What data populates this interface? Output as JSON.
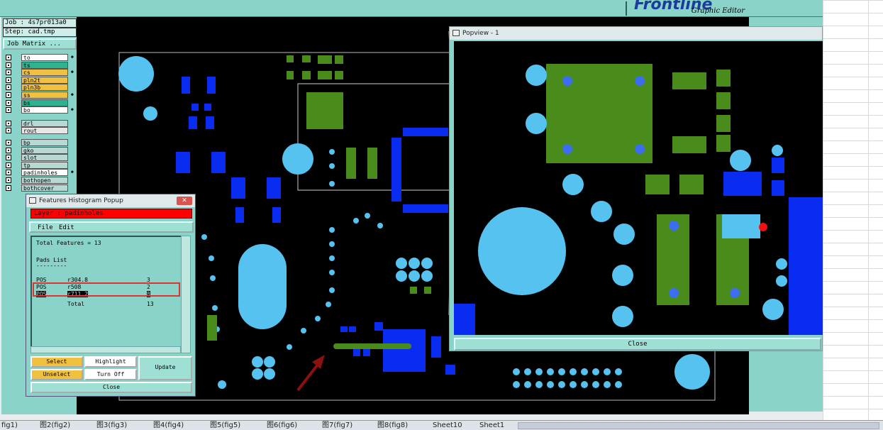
{
  "brand": {
    "logo": "Frontline",
    "subtitle": "Graphic Editor"
  },
  "left_panel": {
    "job": "Job : 4s7pr013a0",
    "step": "Step: cad.tmp",
    "job_matrix": "Job Matrix ...",
    "layers": [
      {
        "name": "to",
        "color": "#ffffff",
        "arrow": true
      },
      {
        "name": "ts",
        "color": "#2db38f",
        "arrow": false
      },
      {
        "name": "cs",
        "color": "#f0c040",
        "arrow": true
      },
      {
        "name": "pln2t",
        "color": "#f0c040",
        "arrow": false
      },
      {
        "name": "pln3b",
        "color": "#f0c040",
        "arrow": false
      },
      {
        "name": "ss",
        "color": "#f0c040",
        "arrow": true
      },
      {
        "name": "bs",
        "color": "#2db38f",
        "arrow": false
      },
      {
        "name": "bo",
        "color": "#ffffff",
        "arrow": true
      },
      {
        "name": "drl",
        "color": "#b8d8d4",
        "arrow": false
      },
      {
        "name": "rout",
        "color": "#e6e6e6",
        "arrow": false
      },
      {
        "name": "bp",
        "color": "#b8d8d4",
        "arrow": false
      },
      {
        "name": "gko",
        "color": "#b8d8d4",
        "arrow": false
      },
      {
        "name": "slot",
        "color": "#b8d8d4",
        "arrow": false
      },
      {
        "name": "tp",
        "color": "#b8d8d4",
        "arrow": false
      },
      {
        "name": "padinholes",
        "color": "#ffffff",
        "arrow": true
      },
      {
        "name": "bothopen",
        "color": "#b8d8d4",
        "arrow": false
      },
      {
        "name": "bothcover",
        "color": "#b8d8d4",
        "arrow": false
      }
    ]
  },
  "popview": {
    "title": "Popview - 1",
    "close": "Close"
  },
  "histogram": {
    "title": "Features Histogram Popup",
    "layer_bar": "Layer :  padinholes",
    "menu_file": "File",
    "menu_edit": "Edit",
    "total_features": "Total Features = 13",
    "pads_list": "Pads List",
    "divider": "---------",
    "rows": [
      {
        "type": "POS",
        "symbol": "r304.8",
        "count": "3"
      },
      {
        "type": "POS",
        "symbol": "r508",
        "count": "2"
      },
      {
        "type": "POS",
        "symbol": "r711.2",
        "count": "8"
      }
    ],
    "total_label": "Total",
    "total_value": "13",
    "buttons": {
      "select": "Select",
      "highlight": "Highlight",
      "update": "Update",
      "unselect": "Unselect",
      "turnoff": "Turn Off",
      "close": "Close"
    }
  },
  "sheet_tabs": [
    "fig1)",
    "图2(fig2)",
    "图3(fig3)",
    "图4(fig4)",
    "图5(fig5)",
    "图6(fig6)",
    "图7(fig7)",
    "图8(fig8)",
    "Sheet10",
    "Sheet1"
  ]
}
